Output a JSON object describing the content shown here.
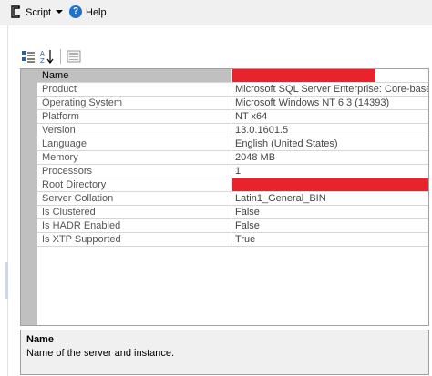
{
  "toolbar": {
    "script_label": "Script",
    "help_label": "Help",
    "script_icon": "script-icon",
    "help_icon": "help-icon",
    "help_glyph": "?"
  },
  "property_grid": {
    "rows": [
      {
        "name": "Name",
        "value": "",
        "redacted": true,
        "selected": true
      },
      {
        "name": "Product",
        "value": "Microsoft SQL Server Enterprise: Core-based Licen"
      },
      {
        "name": "Operating System",
        "value": "Microsoft Windows NT 6.3 (14393)"
      },
      {
        "name": "Platform",
        "value": "NT x64"
      },
      {
        "name": "Version",
        "value": "13.0.1601.5"
      },
      {
        "name": "Language",
        "value": "English (United States)"
      },
      {
        "name": "Memory",
        "value": "2048 MB"
      },
      {
        "name": "Processors",
        "value": "1"
      },
      {
        "name": "Root Directory",
        "value": "",
        "redacted": true
      },
      {
        "name": "Server Collation",
        "value": "Latin1_General_BIN"
      },
      {
        "name": "Is Clustered",
        "value": "False"
      },
      {
        "name": "Is HADR Enabled",
        "value": "False"
      },
      {
        "name": "Is XTP Supported",
        "value": "True"
      }
    ]
  },
  "description": {
    "title": "Name",
    "text": "Name of the server and instance."
  },
  "colors": {
    "redaction": "#e8232b",
    "gutter": "#c0c0c0",
    "help_blue": "#1e73c8"
  }
}
